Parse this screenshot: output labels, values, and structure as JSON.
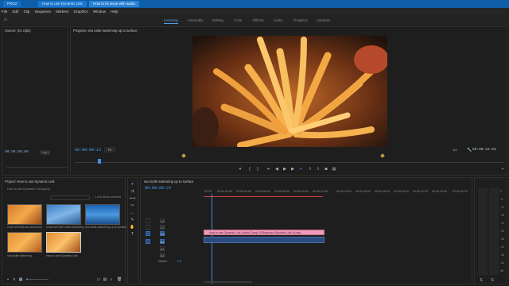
{
  "project_tabs": [
    "PRO2",
    "How to use Dynamic Link",
    "How to fix issue with audio"
  ],
  "menu": [
    "File",
    "Edit",
    "Clip",
    "Sequence",
    "Markers",
    "Graphics",
    "Window",
    "Help"
  ],
  "workspaces": [
    "Learning",
    "Assembly",
    "Editing",
    "Color",
    "Effects",
    "Audio",
    "Graphics",
    "Libraries"
  ],
  "active_workspace": "Learning",
  "source": {
    "title": "Source: (no clips)",
    "timecode": "00;00;00;00",
    "page": "Page 1"
  },
  "program": {
    "title": "Program: sea turtle swimming up to surface",
    "timecode": "00:00:00:13",
    "fit": "Fit",
    "quality": "1/2",
    "duration": "00:00:12:03"
  },
  "project": {
    "title": "Project: How to use Dynamic Link",
    "filename": "How to use Dynamic Link.prproj",
    "selection": "1 of 6 items selected",
    "items": [
      {
        "name": "coral reef with sea anemone"
      },
      {
        "name": "coral reef with turtle swimming"
      },
      {
        "name": "sea turtle swimming up to surface"
      },
      {
        "name": "sea turtle swimming"
      },
      {
        "name": "How to use Dynamic Link"
      }
    ]
  },
  "timeline": {
    "title": "sea turtle swimming up to surface",
    "timecode": "00:00:00:24",
    "ruler": [
      "00:00",
      "00:00:02:00",
      "00:00:04:00",
      "00:00:06:00",
      "00:00:08:00",
      "00:00:10:00",
      "00:00:12:00",
      "00:00:14:00",
      "00:00:16:00",
      "00:00:18:00",
      "00:00:20:00",
      "00:00:22:00",
      "00:00:24:00",
      "00:00:26:00"
    ],
    "video_tracks": [
      "V3",
      "V2",
      "V1"
    ],
    "audio_tracks": [
      "A1",
      "A2",
      "A3"
    ],
    "clip_label": "How to use Dynamic Link Linked Comp 01/Replaced Dynamic Link 44.aep",
    "master_label": "Master",
    "master_value": "0.0"
  },
  "meter_scale": [
    "0",
    "-6",
    "-12",
    "-18",
    "-24",
    "-30",
    "-36",
    "-42",
    "-48",
    "-54",
    "dB"
  ],
  "icons": {
    "home": "home-icon",
    "wrench": "wrench-icon",
    "play": "play-icon",
    "export": "export-frame-icon"
  }
}
